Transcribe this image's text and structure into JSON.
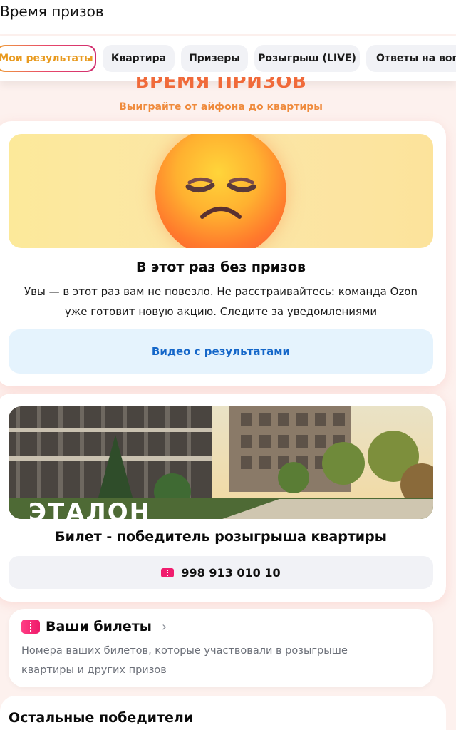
{
  "header": {
    "title": "Время призов"
  },
  "tabs": [
    {
      "label": "Мои результаты",
      "active": true
    },
    {
      "label": "Квартира"
    },
    {
      "label": "Призеры"
    },
    {
      "label": "Розыгрыш (LIVE)"
    },
    {
      "label": "Ответы на вопр"
    }
  ],
  "promo": {
    "title": "ВРЕМЯ ПРИЗОВ",
    "subtitle": "Выиграйте от айфона до квартиры"
  },
  "result_card": {
    "image_icon": "sad-face-emoji-icon",
    "heading": "В этот раз без призов",
    "text_line1": "Увы — в этот раз вам не повезло. Не расстраивайтесь: команда Ozon",
    "text_line2": "уже готовит новую акцию. Следите за уведомлениями",
    "video_button": "Видео с результатами"
  },
  "apartment_card": {
    "image_icon": "apartment-complex-photo",
    "image_caption": "ЭТАЛОН",
    "heading": "Билет - победитель розыгрыша квартиры",
    "ticket_number": "998 913 010 10"
  },
  "your_tickets": {
    "heading": "Ваши билеты",
    "chevron": "›",
    "text_line1": "Номера ваших билетов, которые участвовали в розыгрыше",
    "text_line2": "квартиры и других призов"
  },
  "other_winners": {
    "heading": "Остальные победители"
  },
  "colors": {
    "accent_orange": "#f06a3a",
    "link_blue": "#1567c9",
    "ticket_pink": "#f01d6e"
  }
}
